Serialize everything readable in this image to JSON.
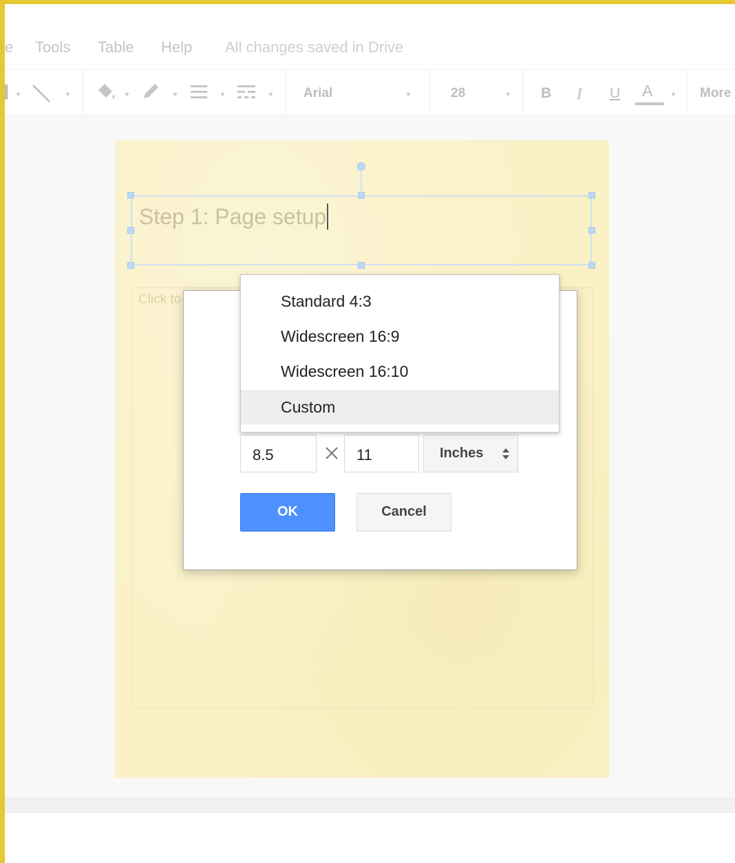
{
  "menu": {
    "items": [
      {
        "label": "e"
      },
      {
        "label": "Tools"
      },
      {
        "label": "Table"
      },
      {
        "label": "Help"
      }
    ],
    "save_status": "All changes saved in Drive"
  },
  "toolbar": {
    "font": "Arial",
    "font_size": "28",
    "bold": "B",
    "italic": "I",
    "underline": "U",
    "text_color": "A",
    "more": "More"
  },
  "slide": {
    "title_text": "Step 1: Page setup",
    "body_placeholder": "Click to",
    "background_color": "#faf1c6"
  },
  "page_setup_dialog": {
    "width_value": "8.5",
    "height_value": "11",
    "unit": "Inches",
    "ok_label": "OK",
    "cancel_label": "Cancel",
    "size_options": [
      {
        "label": "Standard 4:3"
      },
      {
        "label": "Widescreen 16:9"
      },
      {
        "label": "Widescreen 16:10"
      },
      {
        "label": "Custom"
      }
    ],
    "selected_option": "Custom",
    "accent_color": "#4d90fe"
  }
}
